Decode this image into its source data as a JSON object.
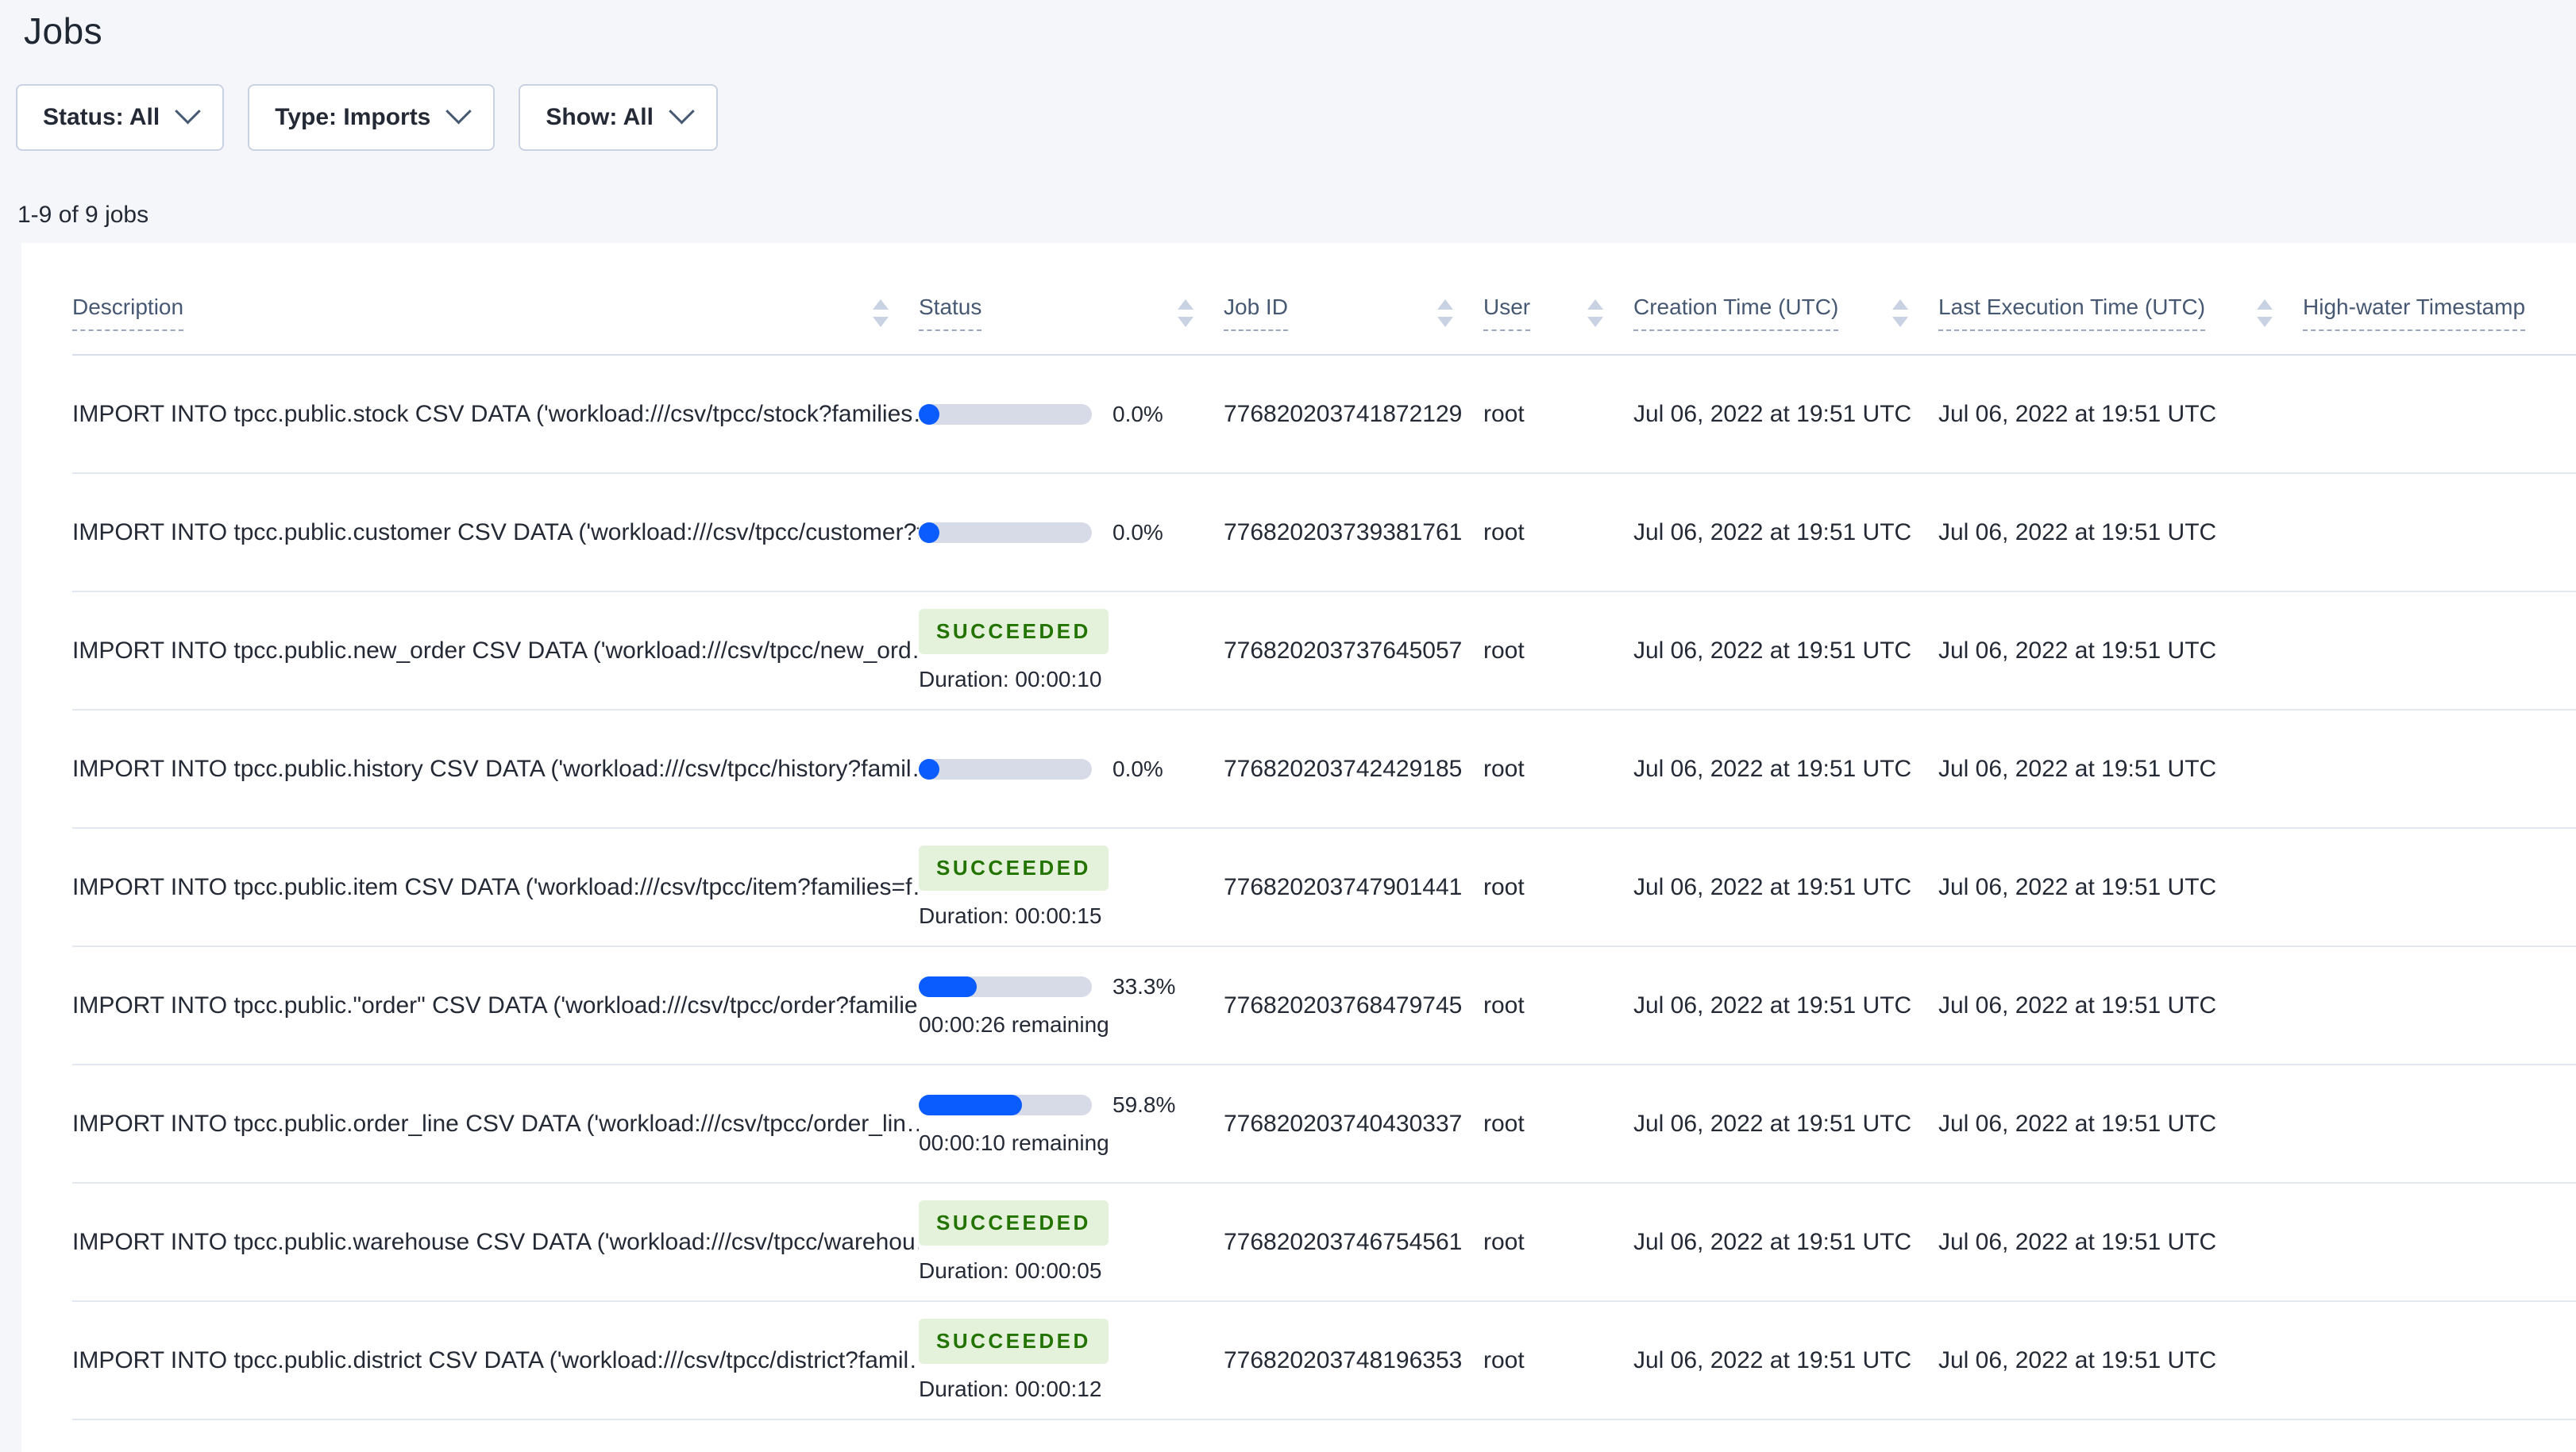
{
  "page": {
    "title": "Jobs",
    "jobs_count": "1-9 of 9 jobs"
  },
  "filters": [
    {
      "label": "Status: All"
    },
    {
      "label": "Type: Imports"
    },
    {
      "label": "Show: All"
    }
  ],
  "table": {
    "columns": [
      "Description",
      "Status",
      "Job ID",
      "User",
      "Creation Time (UTC)",
      "Last Execution Time (UTC)",
      "High-water Timestamp"
    ],
    "sort": {
      "column": "High-water Timestamp",
      "direction": "desc"
    },
    "rows": [
      {
        "description": "IMPORT INTO tpcc.public.stock CSV DATA ('workload:///csv/tpcc/stock?families…",
        "status": {
          "type": "progress",
          "percent": 0.0,
          "percent_label": "0.0%"
        },
        "job_id": "776820203741872129",
        "user": "root",
        "creation_time": "Jul 06, 2022 at 19:51 UTC",
        "last_execution_time": "Jul 06, 2022 at 19:51 UTC",
        "high_water_timestamp": ""
      },
      {
        "description": "IMPORT INTO tpcc.public.customer CSV DATA ('workload:///csv/tpcc/customer?f…",
        "status": {
          "type": "progress",
          "percent": 0.0,
          "percent_label": "0.0%"
        },
        "job_id": "776820203739381761",
        "user": "root",
        "creation_time": "Jul 06, 2022 at 19:51 UTC",
        "last_execution_time": "Jul 06, 2022 at 19:51 UTC",
        "high_water_timestamp": ""
      },
      {
        "description": "IMPORT INTO tpcc.public.new_order CSV DATA ('workload:///csv/tpcc/new_ord…",
        "status": {
          "type": "succeeded",
          "label": "SUCCEEDED",
          "duration": "Duration: 00:00:10"
        },
        "job_id": "776820203737645057",
        "user": "root",
        "creation_time": "Jul 06, 2022 at 19:51 UTC",
        "last_execution_time": "Jul 06, 2022 at 19:51 UTC",
        "high_water_timestamp": ""
      },
      {
        "description": "IMPORT INTO tpcc.public.history CSV DATA ('workload:///csv/tpcc/history?famil…",
        "status": {
          "type": "progress",
          "percent": 0.0,
          "percent_label": "0.0%"
        },
        "job_id": "776820203742429185",
        "user": "root",
        "creation_time": "Jul 06, 2022 at 19:51 UTC",
        "last_execution_time": "Jul 06, 2022 at 19:51 UTC",
        "high_water_timestamp": ""
      },
      {
        "description": "IMPORT INTO tpcc.public.item CSV DATA ('workload:///csv/tpcc/item?families=f…",
        "status": {
          "type": "succeeded",
          "label": "SUCCEEDED",
          "duration": "Duration: 00:00:15"
        },
        "job_id": "776820203747901441",
        "user": "root",
        "creation_time": "Jul 06, 2022 at 19:51 UTC",
        "last_execution_time": "Jul 06, 2022 at 19:51 UTC",
        "high_water_timestamp": ""
      },
      {
        "description": "IMPORT INTO tpcc.public.\"order\" CSV DATA ('workload:///csv/tpcc/order?familie…",
        "status": {
          "type": "progress",
          "percent": 33.3,
          "percent_label": "33.3%",
          "remaining": "00:00:26 remaining"
        },
        "job_id": "776820203768479745",
        "user": "root",
        "creation_time": "Jul 06, 2022 at 19:51 UTC",
        "last_execution_time": "Jul 06, 2022 at 19:51 UTC",
        "high_water_timestamp": ""
      },
      {
        "description": "IMPORT INTO tpcc.public.order_line CSV DATA ('workload:///csv/tpcc/order_lin…",
        "status": {
          "type": "progress",
          "percent": 59.8,
          "percent_label": "59.8%",
          "remaining": "00:00:10 remaining"
        },
        "job_id": "776820203740430337",
        "user": "root",
        "creation_time": "Jul 06, 2022 at 19:51 UTC",
        "last_execution_time": "Jul 06, 2022 at 19:51 UTC",
        "high_water_timestamp": ""
      },
      {
        "description": "IMPORT INTO tpcc.public.warehouse CSV DATA ('workload:///csv/tpcc/warehou…",
        "status": {
          "type": "succeeded",
          "label": "SUCCEEDED",
          "duration": "Duration: 00:00:05"
        },
        "job_id": "776820203746754561",
        "user": "root",
        "creation_time": "Jul 06, 2022 at 19:51 UTC",
        "last_execution_time": "Jul 06, 2022 at 19:51 UTC",
        "high_water_timestamp": ""
      },
      {
        "description": "IMPORT INTO tpcc.public.district CSV DATA ('workload:///csv/tpcc/district?famil…",
        "status": {
          "type": "succeeded",
          "label": "SUCCEEDED",
          "duration": "Duration: 00:00:12"
        },
        "job_id": "776820203748196353",
        "user": "root",
        "creation_time": "Jul 06, 2022 at 19:51 UTC",
        "last_execution_time": "Jul 06, 2022 at 19:51 UTC",
        "high_water_timestamp": ""
      }
    ]
  },
  "colors": {
    "accent_blue": "#0b5cff",
    "progress_track": "#d6dbe7",
    "success_bg": "#e4f2dc",
    "success_text": "#237300",
    "header_text": "#475872",
    "sort_active": "#2563ff"
  }
}
